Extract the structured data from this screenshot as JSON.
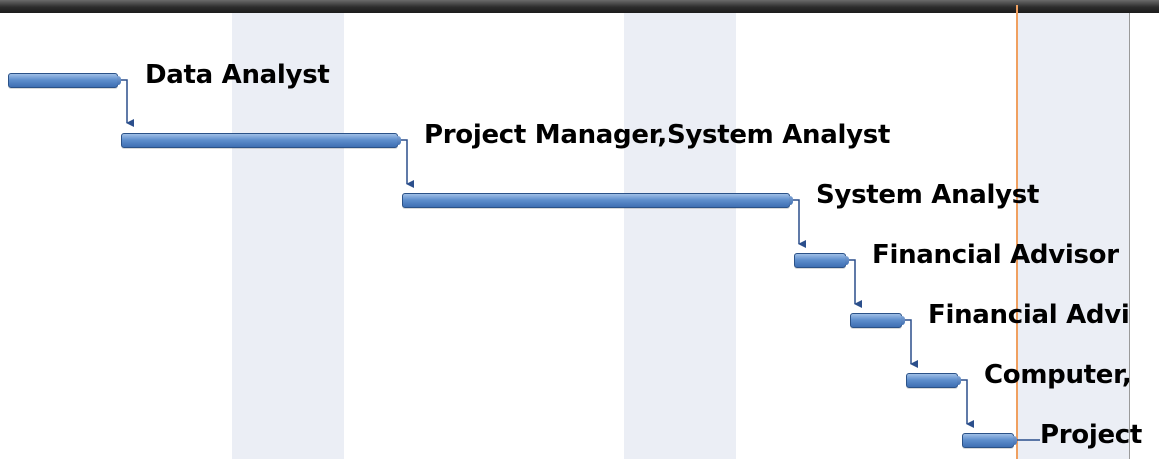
{
  "gantt": {
    "bar_color": "#4f7fc0",
    "connector_color": "#2b4f8c",
    "today_line_color": "#f0a060",
    "weekend_shading_color": "#ebeef5",
    "tasks": [
      {
        "resource_label": "Data Analyst"
      },
      {
        "resource_label": "Project Manager,System Analyst"
      },
      {
        "resource_label": "System Analyst"
      },
      {
        "resource_label": "Financial Advisor"
      },
      {
        "resource_label": "Financial Advi"
      },
      {
        "resource_label": "Computer,"
      },
      {
        "resource_label": "Project"
      }
    ]
  }
}
